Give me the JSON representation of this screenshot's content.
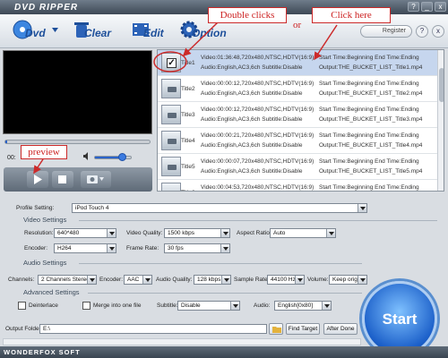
{
  "app": {
    "title": "DVD RIPPER",
    "brand": "WONDERFOX SOFT"
  },
  "titlebar_buttons": {
    "help": "?",
    "min": "_",
    "close": "x"
  },
  "toolbar": {
    "dvd_label": "Dvd",
    "clear_label": "Clear",
    "edit_label": "Edit",
    "option_label": "Option",
    "register_label": "Register",
    "help_label": "?",
    "close_label": "x"
  },
  "annotations": {
    "double_click": "Double clicks",
    "or": "or",
    "click_here": "Click here",
    "preview": "preview"
  },
  "player": {
    "time": "00:"
  },
  "titles": [
    {
      "name": "Title1",
      "checked": true,
      "video": "Video:01:36:48,720x480,NTSC,HDTV(16:9)",
      "audio": "Audio:English,AC3,6ch Subtitle:Disable",
      "start": "Start Time:Beginning End Time:Ending",
      "output": "Output:THE_BUCKET_LIST_Title1.mp4"
    },
    {
      "name": "Title2",
      "checked": false,
      "video": "Video:00:00:12,720x480,NTSC,HDTV(16:9)",
      "audio": "Audio:English,AC3,6ch Subtitle:Disable",
      "start": "Start Time:Beginning End Time:Ending",
      "output": "Output:THE_BUCKET_LIST_Title2.mp4"
    },
    {
      "name": "Title3",
      "checked": false,
      "video": "Video:00:00:12,720x480,NTSC,HDTV(16:9)",
      "audio": "Audio:English,AC3,6ch Subtitle:Disable",
      "start": "Start Time:Beginning End Time:Ending",
      "output": "Output:THE_BUCKET_LIST_Title3.mp4"
    },
    {
      "name": "Title4",
      "checked": false,
      "video": "Video:00:00:21,720x480,NTSC,HDTV(16:9)",
      "audio": "Audio:English,AC3,6ch Subtitle:Disable",
      "start": "Start Time:Beginning End Time:Ending",
      "output": "Output:THE_BUCKET_LIST_Title4.mp4"
    },
    {
      "name": "Title5",
      "checked": false,
      "video": "Video:00:00:07,720x480,NTSC,HDTV(16:9)",
      "audio": "Audio:English,AC3,6ch Subtitle:Disable",
      "start": "Start Time:Beginning End Time:Ending",
      "output": "Output:THE_BUCKET_LIST_Title5.mp4"
    },
    {
      "name": "Title6",
      "checked": false,
      "video": "Video:00:04:53,720x480,NTSC,HDTV(16:9)",
      "audio": "Audio:English,AC3,6ch Subtitle:Disable",
      "start": "Start Time:Beginning End Time:Ending",
      "output": "Output:THE_BUCKET_LIST_Title6.mp4"
    }
  ],
  "profile": {
    "label": "Profile Setting:",
    "value": "iPod Touch 4"
  },
  "video_settings": {
    "heading": "Video Settings",
    "resolution_label": "Resolution:",
    "resolution": "640*480",
    "quality_label": "Video Quality:",
    "quality": "1500 kbps",
    "aspect_label": "Aspect Ratio:",
    "aspect": "Auto",
    "encoder_label": "Encoder:",
    "encoder": "H264",
    "framerate_label": "Frame Rate:",
    "framerate": "30 fps"
  },
  "audio_settings": {
    "heading": "Audio Settings",
    "channels_label": "Channels:",
    "channels": "2 Channels Stereo",
    "encoder_label": "Encoder:",
    "encoder": "AAC",
    "quality_label": "Audio Quality:",
    "quality": "128 kbps",
    "sample_label": "Sample Rate:",
    "sample": "44100 Hz",
    "volume_label": "Volume:",
    "volume": "Keep origina"
  },
  "advanced_settings": {
    "heading": "Advanced Settings",
    "deinterlace": "Deinterlace",
    "merge": "Merge into one file",
    "subtitle_label": "Subtitle:",
    "subtitle": "Disable",
    "audio_label": "Audio:",
    "audio": "English[0x80]"
  },
  "output": {
    "label": "Output Folder:",
    "value": "E:\\",
    "find_target": "Find Target",
    "after_done": "After Done"
  },
  "start_label": "Start",
  "colors": {
    "accent": "#1b5fc9",
    "callout": "#cc2a2a",
    "selected_row": "#c6d6ee"
  }
}
